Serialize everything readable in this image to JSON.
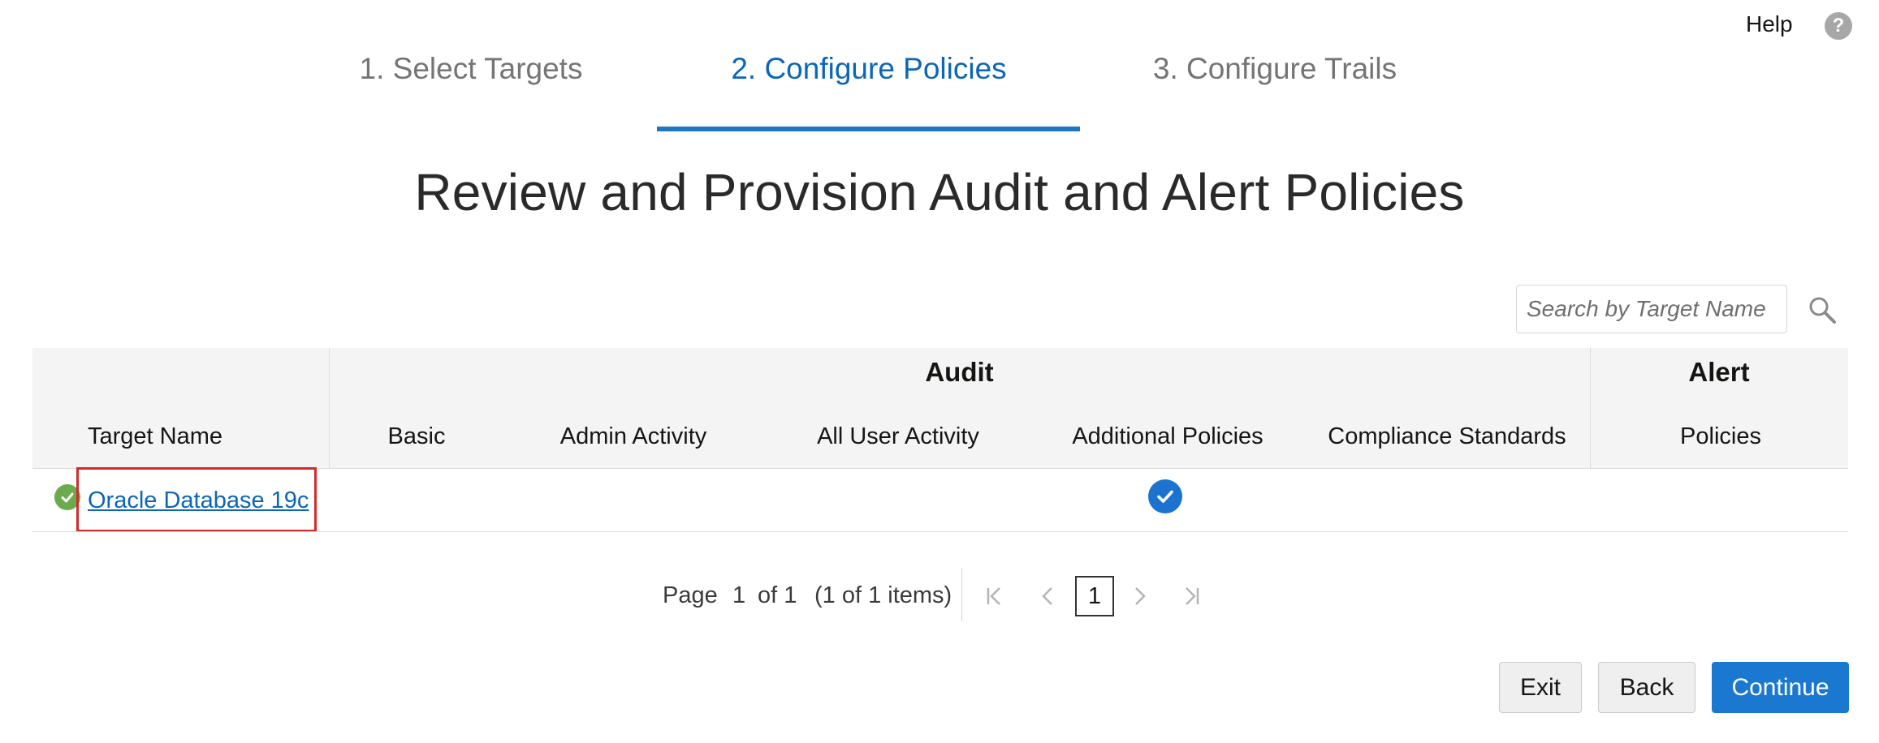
{
  "help": {
    "label": "Help",
    "icon": "help-icon"
  },
  "train": {
    "steps": [
      {
        "label": "1. Select Targets",
        "active": false
      },
      {
        "label": "2. Configure Policies",
        "active": true
      },
      {
        "label": "3. Configure Trails",
        "active": false
      }
    ]
  },
  "page_title": "Review and Provision Audit and Alert Policies",
  "search": {
    "placeholder": "Search by Target Name",
    "value": ""
  },
  "table": {
    "groups": {
      "audit": "Audit",
      "alert": "Alert"
    },
    "columns": {
      "target_name": "Target Name",
      "basic": "Basic",
      "admin_activity": "Admin Activity",
      "all_user_activity": "All User Activity",
      "additional_policies": "Additional Policies",
      "compliance_standards": "Compliance Standards",
      "policies": "Policies"
    },
    "rows": [
      {
        "target_name": "Oracle Database 19c",
        "status": "success",
        "basic": false,
        "admin_activity": false,
        "all_user_activity": false,
        "additional_policies": true,
        "compliance_standards": false,
        "policies": false
      }
    ]
  },
  "pagination": {
    "page_label": "Page",
    "page_value": "1",
    "of_label": "of 1",
    "items_label": "(1 of 1 items)",
    "current": "1"
  },
  "buttons": {
    "exit": "Exit",
    "back": "Back",
    "continue": "Continue"
  },
  "colors": {
    "accent": "#1b78d0",
    "link": "#0b66b8",
    "success": "#6bab4e",
    "highlight": "#d32b2b"
  }
}
